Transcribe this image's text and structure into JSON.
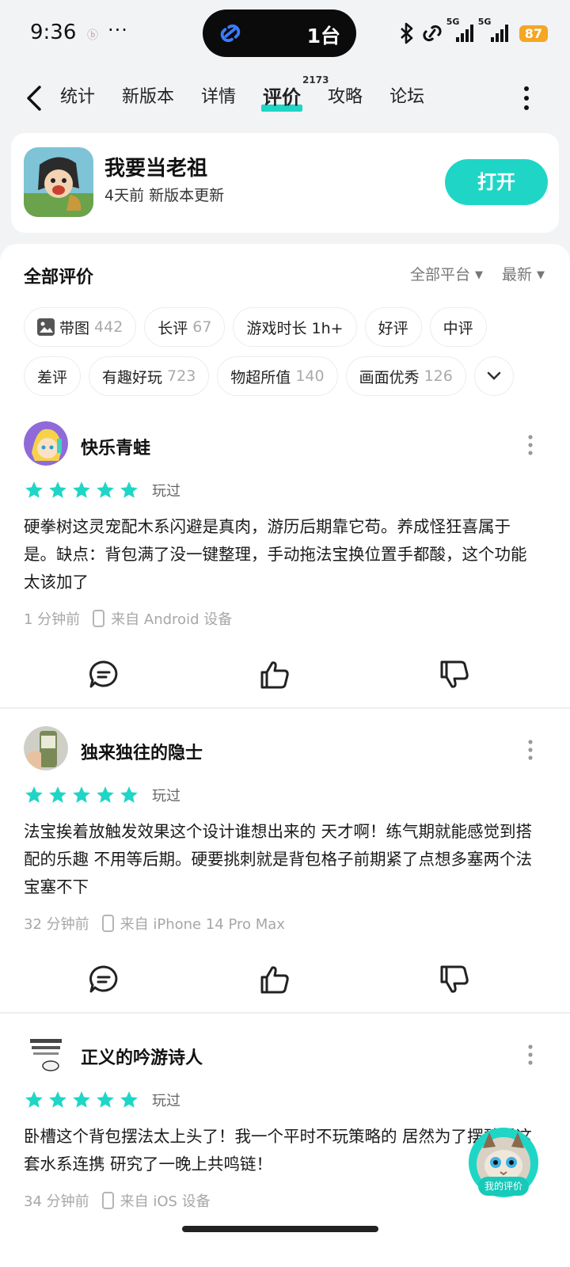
{
  "status_bar": {
    "time": "9:36",
    "small_icon": "ⓑ",
    "dots": "···",
    "island_text": "1台",
    "net1": "5G",
    "net2": "5G",
    "battery": "87"
  },
  "nav": {
    "tabs": [
      {
        "label": "统计",
        "active": false
      },
      {
        "label": "新版本",
        "active": false
      },
      {
        "label": "详情",
        "active": false
      },
      {
        "label": "评价",
        "active": true,
        "badge": "2173"
      },
      {
        "label": "攻略",
        "active": false
      },
      {
        "label": "论坛",
        "active": false
      }
    ]
  },
  "app": {
    "name": "我要当老祖",
    "subtitle": "4天前 新版本更新",
    "open_label": "打开"
  },
  "reviews_header": {
    "title": "全部评价",
    "platform_filter": "全部平台",
    "sort_filter": "最新"
  },
  "chips": {
    "row1": [
      {
        "label": "带图",
        "count": "442",
        "icon": "image-icon"
      },
      {
        "label": "长评",
        "count": "67"
      },
      {
        "label": "游戏时长 1h+",
        "count": ""
      },
      {
        "label": "好评",
        "count": ""
      },
      {
        "label": "中评",
        "count": ""
      }
    ],
    "row2": [
      {
        "label": "差评",
        "count": ""
      },
      {
        "label": "有趣好玩",
        "count": "723"
      },
      {
        "label": "物超所值",
        "count": "140"
      },
      {
        "label": "画面优秀",
        "count": "126"
      }
    ]
  },
  "reviews": [
    {
      "name": "快乐青蛙",
      "stars": 5,
      "played": "玩过",
      "text": "硬拳树这灵宠配木系闪避是真肉，游历后期靠它苟。养成怪狂喜属于是。缺点：背包满了没一键整理，手动拖法宝换位置手都酸，这个功能太该加了",
      "time": "1 分钟前",
      "device": "来自 Android 设备"
    },
    {
      "name": "独来独往的隐士",
      "stars": 5,
      "played": "玩过",
      "text": "法宝挨着放触发效果这个设计谁想出来的 天才啊！练气期就能感觉到搭配的乐趣 不用等后期。硬要挑刺就是背包格子前期紧了点想多塞两个法宝塞不下",
      "time": "32 分钟前",
      "device": "来自 iPhone 14 Pro Max"
    },
    {
      "name": "正义的吟游诗人",
      "stars": 5,
      "played": "玩过",
      "text": "卧槽这个背包摆法太上头了！我一个平时不玩策略的 居然为了摆碧霄这套水系连携 研究了一晚上共鸣链！",
      "time": "34 分钟前",
      "device": "来自 iOS 设备"
    }
  ],
  "float": {
    "label": "我的评价"
  },
  "colors": {
    "accent": "#1fd6c6",
    "star": "#1fd6c6",
    "battery": "#f5a623"
  }
}
